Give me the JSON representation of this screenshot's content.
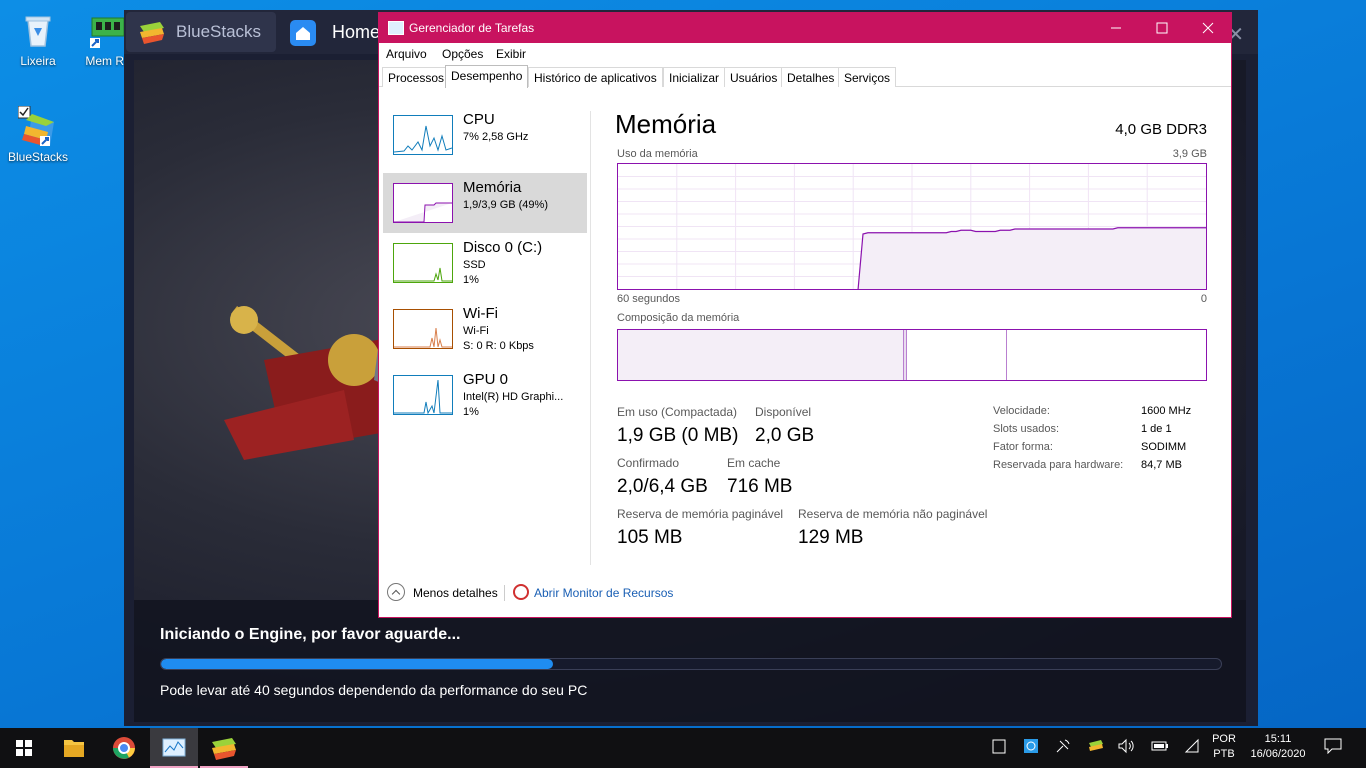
{
  "desktop": {
    "icons": [
      {
        "label": "Lixeira"
      },
      {
        "label": "Mem Re"
      },
      {
        "label": "BlueStacks"
      }
    ]
  },
  "bluestacks": {
    "tab_label": "BlueStacks",
    "home_label": "Home",
    "close_glyph": "✕",
    "loading_message": "Iniciando o Engine, por favor aguarde...",
    "loading_sub": "Pode levar até 40 segundos dependendo da performance do seu PC",
    "progress": 0.37
  },
  "taskmgr": {
    "title": "Gerenciador de Tarefas",
    "menu": [
      "Arquivo",
      "Opções",
      "Exibir"
    ],
    "tabs": [
      "Processos",
      "Desempenho",
      "Histórico de aplicativos",
      "Inicializar",
      "Usuários",
      "Detalhes",
      "Serviços"
    ],
    "active_tab": 1,
    "sidebar": [
      {
        "name": "CPU",
        "line1": "7% 2,58 GHz",
        "line2": "",
        "color": "#117dbb"
      },
      {
        "name": "Memória",
        "line1": "1,9/3,9 GB (49%)",
        "line2": "",
        "color": "#8b12ae"
      },
      {
        "name": "Disco 0 (C:)",
        "line1": "SSD",
        "line2": "1%",
        "color": "#4da60c"
      },
      {
        "name": "Wi-Fi",
        "line1": "Wi-Fi",
        "line2": "S: 0 R: 0 Kbps",
        "color": "#a74f01"
      },
      {
        "name": "GPU 0",
        "line1": "Intel(R) HD Graphi...",
        "line2": "1%",
        "color": "#117dbb"
      }
    ],
    "main": {
      "title": "Memória",
      "spec": "4,0 GB DDR3",
      "usage_label": "Uso da memória",
      "usage_max": "3,9 GB",
      "time_left": "60 segundos",
      "time_right": "0",
      "composition_label": "Composição da memória",
      "stats": {
        "in_use_label": "Em uso (Compactada)",
        "in_use_value": "1,9 GB (0 MB)",
        "available_label": "Disponível",
        "available_value": "2,0 GB",
        "committed_label": "Confirmado",
        "committed_value": "2,0/6,4 GB",
        "cached_label": "Em cache",
        "cached_value": "716 MB",
        "paged_label": "Reserva de memória paginável",
        "paged_value": "105 MB",
        "nonpaged_label": "Reserva de memória não paginável",
        "nonpaged_value": "129 MB"
      },
      "details": [
        {
          "key": "Velocidade:",
          "value": "1600 MHz"
        },
        {
          "key": "Slots usados:",
          "value": "1 de 1"
        },
        {
          "key": "Fator forma:",
          "value": "SODIMM"
        },
        {
          "key": "Reservada para hardware:",
          "value": "84,7 MB"
        }
      ],
      "composition_fractions": [
        0.485,
        0.005,
        0.17,
        0.34
      ],
      "usage_series": [
        0,
        0,
        0,
        0,
        0,
        0,
        0,
        0,
        0,
        0,
        0,
        0,
        0,
        0,
        0,
        0,
        0,
        0,
        0,
        0,
        0,
        0,
        0,
        0,
        0,
        0,
        0,
        0,
        0,
        0,
        0,
        0,
        0,
        0,
        0,
        0,
        0,
        0,
        0,
        0,
        0,
        0,
        0,
        0,
        0,
        0,
        0,
        0,
        0,
        0,
        0.44,
        0.45,
        0.45,
        0.45,
        0.45,
        0.45,
        0.45,
        0.45,
        0.45,
        0.45,
        0.45,
        0.45,
        0.45,
        0.45,
        0.45,
        0.45,
        0.45,
        0.45,
        0.46,
        0.46,
        0.47,
        0.47,
        0.47,
        0.46,
        0.46,
        0.46,
        0.46,
        0.46,
        0.47,
        0.47,
        0.47,
        0.48,
        0.48,
        0.48,
        0.48,
        0.48,
        0.48,
        0.48,
        0.48,
        0.48,
        0.48,
        0.48,
        0.48,
        0.48,
        0.48,
        0.48,
        0.48,
        0.48,
        0.48,
        0.48,
        0.48,
        0.48,
        0.49,
        0.49,
        0.49,
        0.49,
        0.49,
        0.49,
        0.49,
        0.49,
        0.49,
        0.49,
        0.49,
        0.49,
        0.49,
        0.49,
        0.49,
        0.49,
        0.49,
        0.49,
        0.49
      ]
    },
    "footer": {
      "less_details": "Menos detalhes",
      "resource_monitor": "Abrir Monitor de Recursos"
    },
    "accent": "#c8135f"
  },
  "taskbar": {
    "lang_top": "POR",
    "lang_bottom": "PTB",
    "time": "15:11",
    "date": "16/06/2020"
  }
}
